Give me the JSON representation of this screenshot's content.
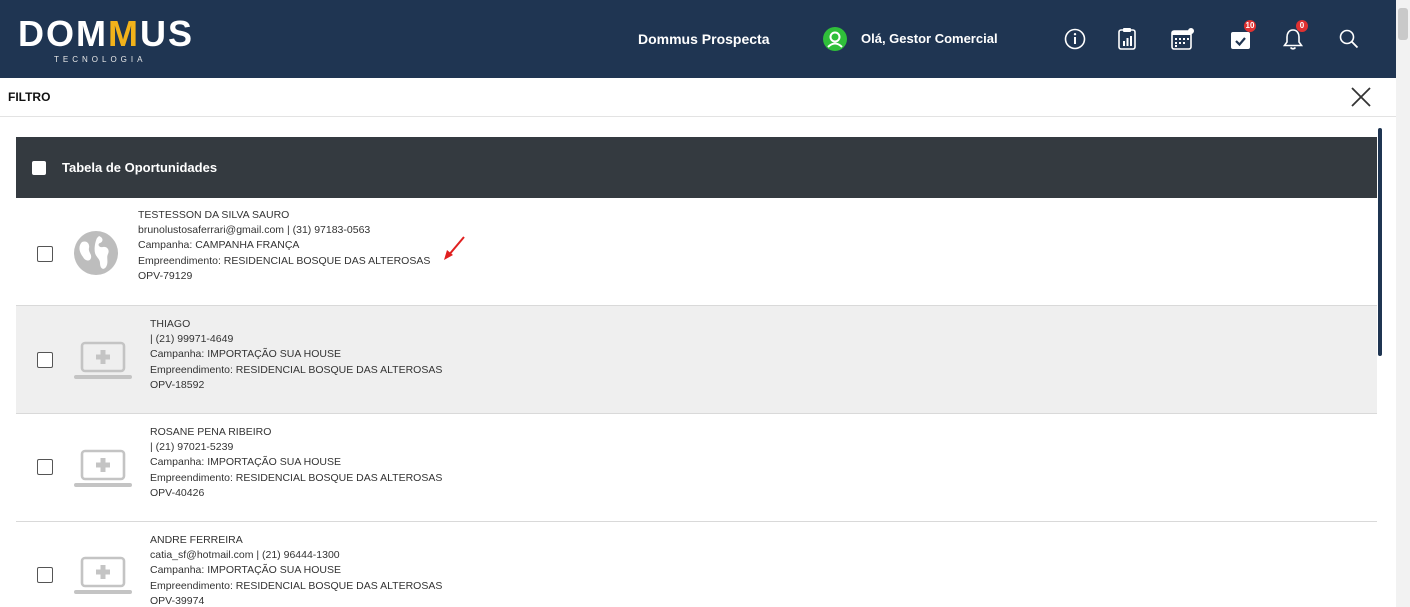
{
  "header": {
    "logo_text_1": "DO",
    "logo_text_2": "M",
    "logo_text_3": "M",
    "logo_text_4": "US",
    "logo_subtitle": "TECNOLOGIA",
    "app_name": "Dommus Prospecta",
    "greeting": "Olá, Gestor Comercial",
    "tasks_badge": "10",
    "notifications_badge": "0",
    "brand_color": "#1f3552",
    "accent_color": "#f2b21a"
  },
  "filter": {
    "label": "FILTRO"
  },
  "table": {
    "title": "Tabela de Oportunidades",
    "rows": [
      {
        "icon": "globe-icon",
        "name": "TESTESSON DA SILVA SAURO",
        "contact": "brunolustosaferrari@gmail.com | (31) 97183-0563",
        "campaign": "Campanha: CAMPANHA FRANÇA",
        "development": "Empreendimento: RESIDENCIAL BOSQUE DAS ALTEROSAS",
        "code": "OPV-79129"
      },
      {
        "icon": "laptop-plus-icon",
        "name": "THIAGO",
        "contact": "| (21) 99971-4649",
        "campaign": "Campanha: IMPORTAÇÃO SUA HOUSE",
        "development": "Empreendimento: RESIDENCIAL BOSQUE DAS ALTEROSAS",
        "code": "OPV-18592"
      },
      {
        "icon": "laptop-plus-icon",
        "name": "ROSANE PENA RIBEIRO",
        "contact": "| (21) 97021-5239",
        "campaign": "Campanha: IMPORTAÇÃO SUA HOUSE",
        "development": "Empreendimento: RESIDENCIAL BOSQUE DAS ALTEROSAS",
        "code": "OPV-40426"
      },
      {
        "icon": "laptop-plus-icon",
        "name": "ANDRE FERREIRA",
        "contact": "catia_sf@hotmail.com | (21) 96444-1300",
        "campaign": "Campanha: IMPORTAÇÃO SUA HOUSE",
        "development": "Empreendimento: RESIDENCIAL BOSQUE DAS ALTEROSAS",
        "code": "OPV-39974"
      }
    ]
  }
}
